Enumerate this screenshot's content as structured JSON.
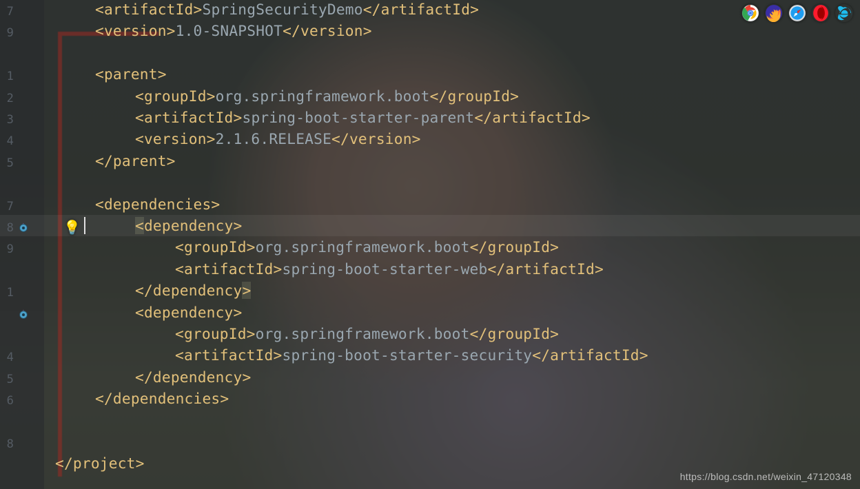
{
  "watermark": "https://blog.csdn.net/weixin_47120348",
  "browsers": [
    "chrome",
    "firefox",
    "safari",
    "opera",
    "ie"
  ],
  "cursor_row": 8,
  "rows": [
    {
      "n": 7,
      "indent": 1,
      "kind": "elem",
      "tag": "artifactId",
      "value": "SpringSecurityDemo"
    },
    {
      "n": 9,
      "indent": 1,
      "kind": "elem",
      "tag": "version",
      "value": "1.0-SNAPSHOT"
    },
    {
      "n": null,
      "indent": 0,
      "kind": "blank"
    },
    {
      "n": 1,
      "indent": 1,
      "kind": "open",
      "tag": "parent"
    },
    {
      "n": 2,
      "indent": 2,
      "kind": "elem",
      "tag": "groupId",
      "value": "org.springframework.boot"
    },
    {
      "n": 3,
      "indent": 2,
      "kind": "elem",
      "tag": "artifactId",
      "value": "spring-boot-starter-parent"
    },
    {
      "n": 4,
      "indent": 2,
      "kind": "elem",
      "tag": "version",
      "value": "2.1.6.RELEASE"
    },
    {
      "n": 5,
      "indent": 1,
      "kind": "close",
      "tag": "parent"
    },
    {
      "n": null,
      "indent": 0,
      "kind": "blank"
    },
    {
      "n": 7,
      "indent": 1,
      "kind": "open",
      "tag": "dependencies"
    },
    {
      "n": 8,
      "indent": 2,
      "kind": "open",
      "tag": "dependency",
      "icons": [
        "override",
        "bulb"
      ],
      "cursor": true,
      "hl_open": true
    },
    {
      "n": 9,
      "indent": 3,
      "kind": "elem",
      "tag": "groupId",
      "value": "org.springframework.boot"
    },
    {
      "n": null,
      "indent": 3,
      "kind": "elem",
      "tag": "artifactId",
      "value": "spring-boot-starter-web"
    },
    {
      "n": 1,
      "indent": 2,
      "kind": "close",
      "tag": "dependency",
      "hl_close": true
    },
    {
      "n": null,
      "indent": 2,
      "kind": "open",
      "tag": "dependency",
      "icons": [
        "override"
      ]
    },
    {
      "n": null,
      "indent": 3,
      "kind": "elem",
      "tag": "groupId",
      "value": "org.springframework.boot"
    },
    {
      "n": 4,
      "indent": 3,
      "kind": "elem",
      "tag": "artifactId",
      "value": "spring-boot-starter-security"
    },
    {
      "n": 5,
      "indent": 2,
      "kind": "close",
      "tag": "dependency"
    },
    {
      "n": 6,
      "indent": 1,
      "kind": "close",
      "tag": "dependencies"
    },
    {
      "n": null,
      "indent": 0,
      "kind": "blank"
    },
    {
      "n": 8,
      "indent": 0,
      "kind": "blank"
    },
    {
      "n": null,
      "indent": 0,
      "kind": "close",
      "tag": "project"
    }
  ]
}
